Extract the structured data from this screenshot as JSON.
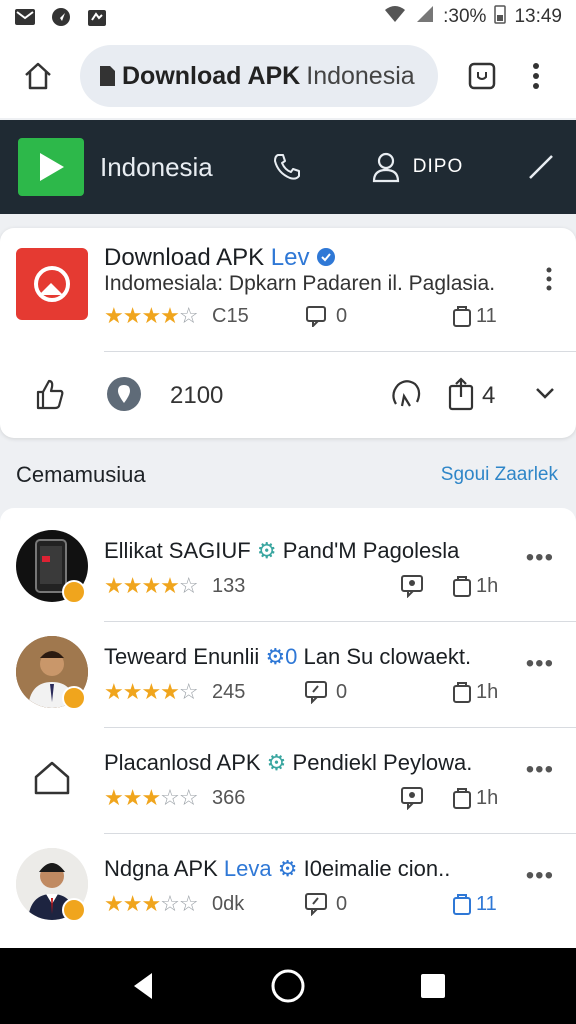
{
  "status": {
    "battery": ":30%",
    "time": "13:49"
  },
  "browser": {
    "url_strong": "Download APK",
    "url_rest": "Indonesia"
  },
  "header": {
    "title": "Indonesia",
    "user_label": "DIPO"
  },
  "featured": {
    "title": "Download APK",
    "title_accent": "Lev",
    "subtitle": "Indomesiala: Dpkarn Padaren il. Paglasia.",
    "stars_on": 4,
    "stars_off": 1,
    "rating_count": "C15",
    "comments": "0",
    "pages": "11",
    "likes": "2100",
    "shares": "4"
  },
  "section": {
    "title": "Cemamusiua",
    "link": "Sgoui Zaarlek"
  },
  "items": [
    {
      "name": "Ellikat SAGIUF",
      "accent": "",
      "desc": "Pand'M Pagolesla",
      "stars_on": 4,
      "count": "133",
      "time": "1h",
      "avatar": "phone-avatar"
    },
    {
      "name": "Teweard Enunlii",
      "accent": "0",
      "desc": "Lan Su clowaekt.",
      "stars_on": 4,
      "count": "245",
      "comments": "0",
      "time": "1h",
      "avatar": "person-avatar"
    },
    {
      "name": "Placanlosd APK",
      "accent": "",
      "desc": "Pendiekl Peylowa.",
      "stars_on": 3,
      "count": "366",
      "time": "1h",
      "avatar": "house-avatar"
    },
    {
      "name": "Ndgna APK",
      "accent": "Leva",
      "desc": "I0eimalie cion..",
      "stars_on": 3,
      "count": "0dk",
      "comments": "0",
      "time": "11",
      "avatar": "person-avatar"
    }
  ],
  "colors": {
    "accent_blue": "#2f78d6",
    "star": "#f0a51d",
    "header_bg": "#1f2a33",
    "play_green": "#2db84a",
    "app_red": "#e53a32"
  }
}
